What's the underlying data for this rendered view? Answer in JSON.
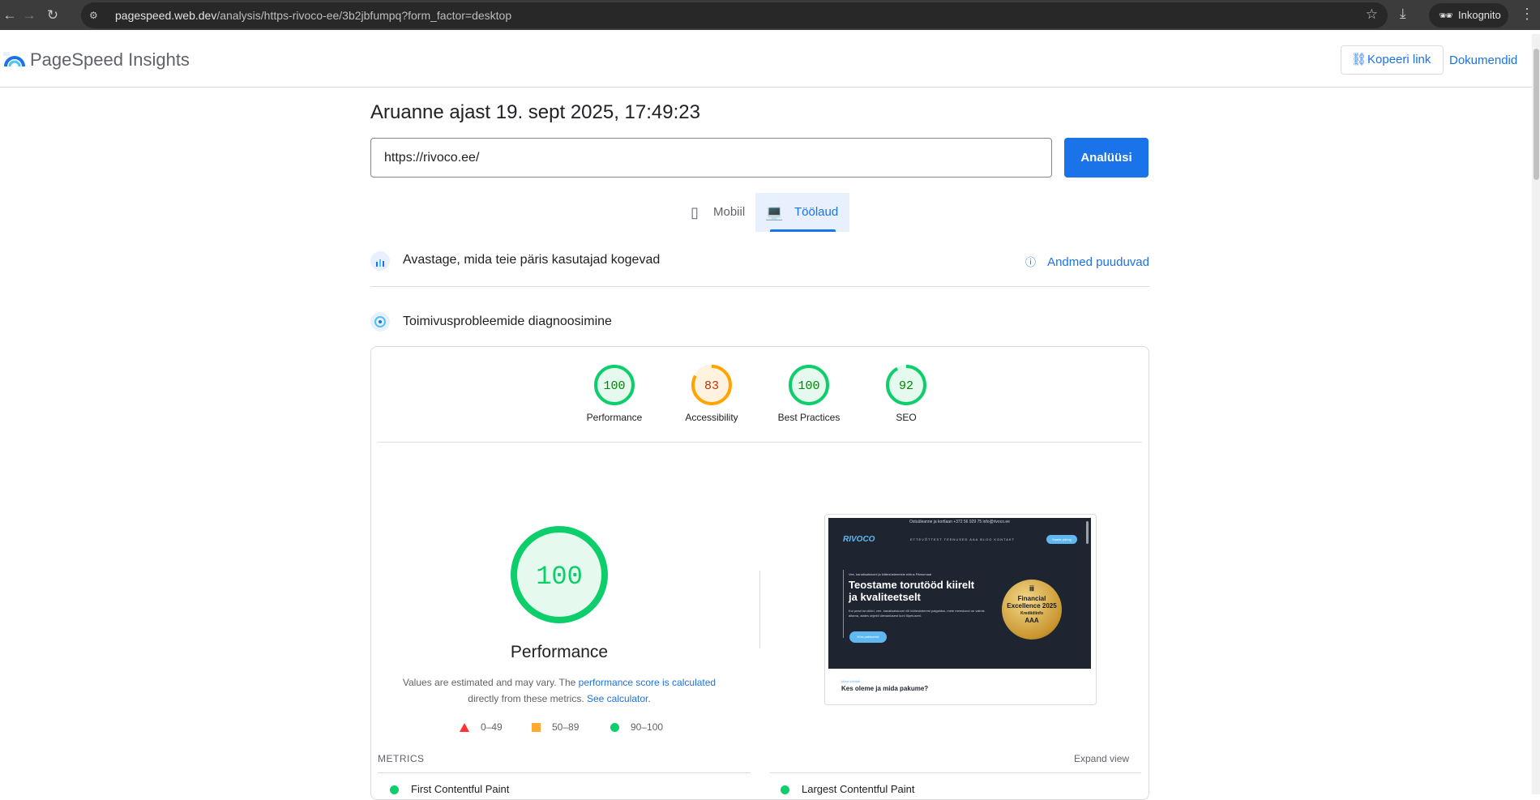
{
  "browser": {
    "url_host": "pagespeed.web.dev",
    "url_path": "/analysis/https-rivoco-ee/3b2jbfumpq?form_factor=desktop",
    "incognito_label": "Inkognito"
  },
  "header": {
    "brand": "PageSpeed Insights",
    "copy_link": "Kopeeri link",
    "docs": "Dokumendid"
  },
  "report": {
    "title": "Aruanne ajast 19. sept 2025, 17:49:23",
    "url_value": "https://rivoco.ee/",
    "analyze_label": "Analüüsi"
  },
  "tabs": [
    {
      "label": "Mobiil",
      "active": false
    },
    {
      "label": "Töölaud",
      "active": true
    }
  ],
  "sections": {
    "field": {
      "title": "Avastage, mida teie päris kasutajad kogevad",
      "status": "Andmed puuduvad"
    },
    "lab": {
      "title": "Toimivusprobleemide diagnoosimine"
    }
  },
  "scores": [
    {
      "label": "Performance",
      "value": "100",
      "pct": 100,
      "color": "#0cce6b",
      "text_color": "#008800",
      "bg": "#e6f9ee"
    },
    {
      "label": "Accessibility",
      "value": "83",
      "pct": 83,
      "color": "#ffa400",
      "text_color": "#c33300",
      "bg": "#fff3e0"
    },
    {
      "label": "Best Practices",
      "value": "100",
      "pct": 100,
      "color": "#0cce6b",
      "text_color": "#008800",
      "bg": "#e6f9ee"
    },
    {
      "label": "SEO",
      "value": "92",
      "pct": 92,
      "color": "#0cce6b",
      "text_color": "#008800",
      "bg": "#e6f9ee"
    }
  ],
  "performance": {
    "score": "100",
    "title": "Performance",
    "note_1": "Values are estimated and may vary. The ",
    "note_link_1": "performance score is calculated",
    "note_2": " directly from these metrics. ",
    "note_link_2": "See calculator",
    "note_3": "."
  },
  "legend": [
    {
      "shape": "triangle",
      "range": "0–49",
      "color": "#ff3333"
    },
    {
      "shape": "square",
      "range": "50–89",
      "color": "#ffaa33"
    },
    {
      "shape": "circle",
      "range": "90–100",
      "color": "#0cce6b"
    }
  ],
  "screenshot": {
    "topbar": "Ostuüleanne ja kortlaan       +372 56 929 75   info@rivoco.ee",
    "logo": "RIVOCO",
    "nav": "ETTEVÕTTEST   TEENUSED   AAA   BLOG   KONTAKT",
    "cta": "Saada päring",
    "tag": "Vee, kanalisatsiooni ja küttesüsteemide ehitus Pärnumaal",
    "headline": "Teostame torutööd kiirelt ja kvaliteetselt",
    "body": "Kui pead torutööd, vee- kanalisatsiooni või küttesüsteemi paigaldus, meie meeskond on valmis aitama, alates objekti ülevaatusest kuni lõpetuseni.",
    "button": "Küsi pakkumist",
    "medal_1": "ᎥᎥᎥ",
    "medal_2": "Financial Excellence 2025",
    "medal_3": "Krediidiinfo",
    "medal_4": "AAA",
    "footer_small": "Meist lühidalt",
    "footer_head": "Kes oleme ja mida pakume?"
  },
  "metrics": {
    "label": "METRICS",
    "expand": "Expand view",
    "items": [
      "First Contentful Paint",
      "Largest Contentful Paint"
    ]
  },
  "colors": {
    "accent": "#1a73e8",
    "pass": "#0cce6b",
    "average": "#ffa400",
    "fail": "#ff3333"
  }
}
